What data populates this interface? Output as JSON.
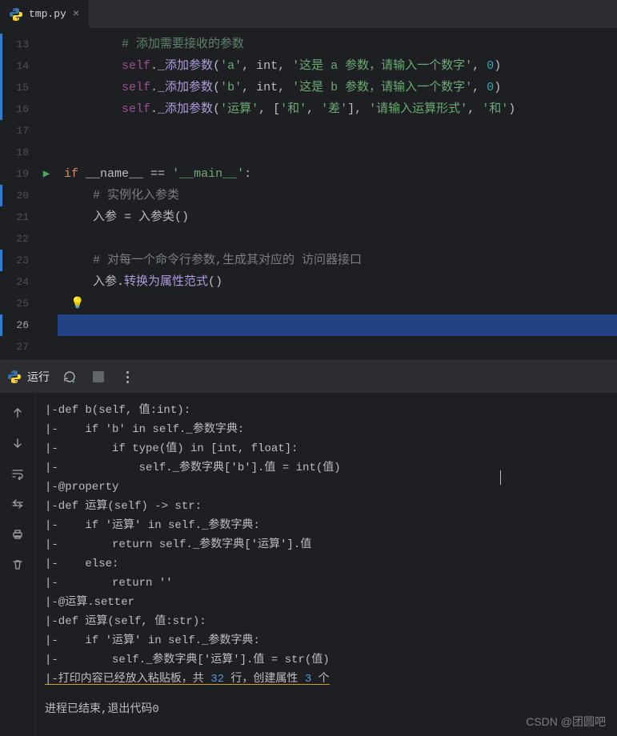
{
  "tab": {
    "filename": "tmp.py"
  },
  "editor": {
    "lines": [
      {
        "num": "13",
        "mod": true,
        "truncated": true,
        "raw": "        # 添加需要接收的参数"
      },
      {
        "num": "14",
        "mod": true,
        "tokens": [
          [
            "self",
            "self"
          ],
          [
            "punc",
            "."
          ],
          [
            "fn",
            "_添加参数"
          ],
          [
            "punc",
            "("
          ],
          [
            "str",
            "'a'"
          ],
          [
            "punc",
            ", "
          ],
          [
            "ident",
            "int"
          ],
          [
            "punc",
            ", "
          ],
          [
            "str",
            "'这是 a 参数，请输入一个数字'"
          ],
          [
            "punc",
            ", "
          ],
          [
            "num",
            "0"
          ],
          [
            "punc",
            ")"
          ]
        ],
        "indent": "        "
      },
      {
        "num": "15",
        "mod": true,
        "tokens": [
          [
            "self",
            "self"
          ],
          [
            "punc",
            "."
          ],
          [
            "fn",
            "_添加参数"
          ],
          [
            "punc",
            "("
          ],
          [
            "str",
            "'b'"
          ],
          [
            "punc",
            ", "
          ],
          [
            "ident",
            "int"
          ],
          [
            "punc",
            ", "
          ],
          [
            "str",
            "'这是 b 参数，请输入一个数字'"
          ],
          [
            "punc",
            ", "
          ],
          [
            "num",
            "0"
          ],
          [
            "punc",
            ")"
          ]
        ],
        "indent": "        "
      },
      {
        "num": "16",
        "mod": true,
        "tokens": [
          [
            "self",
            "self"
          ],
          [
            "punc",
            "."
          ],
          [
            "fn",
            "_添加参数"
          ],
          [
            "punc",
            "("
          ],
          [
            "str",
            "'运算'"
          ],
          [
            "punc",
            ", ["
          ],
          [
            "str",
            "'和'"
          ],
          [
            "punc",
            ", "
          ],
          [
            "str",
            "'差'"
          ],
          [
            "punc",
            "], "
          ],
          [
            "str",
            "'请输入运算形式'"
          ],
          [
            "punc",
            ", "
          ],
          [
            "str",
            "'和'"
          ],
          [
            "punc",
            ")"
          ]
        ],
        "indent": "        "
      },
      {
        "num": "17",
        "mod": false,
        "tokens": [],
        "indent": ""
      },
      {
        "num": "18",
        "mod": false,
        "tokens": [],
        "indent": ""
      },
      {
        "num": "19",
        "mod": false,
        "run": true,
        "tokens": [
          [
            "kw",
            "if"
          ],
          [
            "op",
            " "
          ],
          [
            "ident",
            "__name__"
          ],
          [
            "op",
            " == "
          ],
          [
            "str",
            "'__main__'"
          ],
          [
            "punc",
            ":"
          ]
        ],
        "indent": ""
      },
      {
        "num": "20",
        "mod": true,
        "tokens": [
          [
            "cmt",
            "# 实例化入参类"
          ]
        ],
        "indent": "    "
      },
      {
        "num": "21",
        "mod": false,
        "tokens": [
          [
            "ident",
            "入参 = 入参类()"
          ]
        ],
        "indent": "    "
      },
      {
        "num": "22",
        "mod": false,
        "tokens": [],
        "indent": ""
      },
      {
        "num": "23",
        "mod": true,
        "tokens": [
          [
            "cmt",
            "# 对每一个命令行参数,生成其对应的 访问器接口"
          ]
        ],
        "indent": "    "
      },
      {
        "num": "24",
        "mod": false,
        "tokens": [
          [
            "ident",
            "入参."
          ],
          [
            "fn",
            "转换为属性范式"
          ],
          [
            "punc",
            "()"
          ]
        ],
        "indent": "    "
      },
      {
        "num": "25",
        "mod": false,
        "bulb": true,
        "tokens": [],
        "indent": ""
      },
      {
        "num": "26",
        "mod": true,
        "current": true,
        "tokens": [],
        "indent": ""
      },
      {
        "num": "27",
        "mod": false,
        "half": true,
        "tokens": [],
        "indent": ""
      }
    ]
  },
  "panel": {
    "title": "运行",
    "output": [
      {
        "t": "|-def b(self, 值:int):"
      },
      {
        "t": "|-    if 'b' in self._参数字典:"
      },
      {
        "t": "|-        if type(值) in [int, float]:"
      },
      {
        "t": "|-            self._参数字典['b'].值 = int(值)"
      },
      {
        "t": "|-@property"
      },
      {
        "t": "|-def 运算(self) -> str:"
      },
      {
        "t": "|-    if '运算' in self._参数字典:"
      },
      {
        "t": "|-        return self._参数字典['运算'].值"
      },
      {
        "t": "|-    else:"
      },
      {
        "t": "|-        return ''"
      },
      {
        "t": "|-@运算.setter"
      },
      {
        "t": "|-def 运算(self, 值:str):"
      },
      {
        "t": "|-    if '运算' in self._参数字典:"
      },
      {
        "t": "|-        self._参数字典['运算'].值 = str(值)"
      },
      {
        "hl": true,
        "parts": [
          [
            "",
            "|-打印内容已经放入粘贴板，共 "
          ],
          [
            "num2",
            "32"
          ],
          [
            "",
            " 行，创建属性 "
          ],
          [
            "num2",
            "3"
          ],
          [
            "",
            " 个"
          ]
        ]
      }
    ],
    "final_line": "进程已结束,退出代码0"
  },
  "watermark": "CSDN @团圆吧"
}
